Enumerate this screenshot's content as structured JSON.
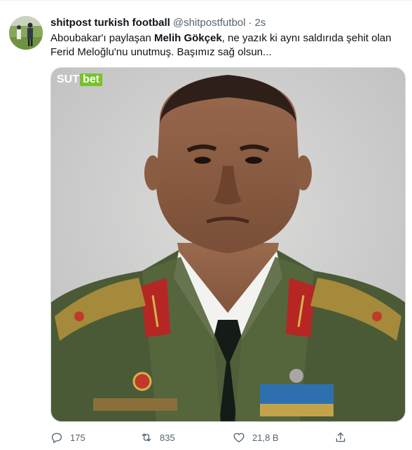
{
  "tweet": {
    "author_name": "shitpost turkish football",
    "author_handle": "@shitpostfutbol",
    "separator": "·",
    "time": "2s",
    "text_before": "Aboubakar'ı paylaşan ",
    "text_bold": "Melih Gökçek",
    "text_after": ", ne yazık ki aynı saldırıda şehit olan Ferid Meloğlu'nu unutmuş. Başımız sağ olsun...",
    "media": {
      "watermark_left": "SUT",
      "watermark_right": "bet"
    }
  },
  "actions": {
    "reply_count": "175",
    "retweet_count": "835",
    "like_count": "21,8 B"
  },
  "icons": [
    "avatar-image",
    "reply-icon",
    "retweet-icon",
    "like-icon",
    "share-icon"
  ],
  "colors": {
    "text_primary": "#0f1419",
    "text_secondary": "#536471",
    "uniform_green": "#4b5a36",
    "collar_red": "#c02a25",
    "watermark_green": "#78c22b"
  }
}
